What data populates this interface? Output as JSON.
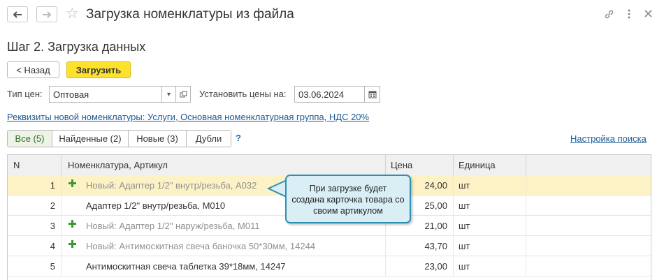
{
  "window": {
    "title": "Загрузка номенклатуры из файла"
  },
  "step_title": "Шаг 2. Загрузка данных",
  "buttons": {
    "back": "< Назад",
    "load": "Загрузить"
  },
  "form": {
    "price_type_label": "Тип цен:",
    "price_type_value": "Оптовая",
    "set_prices_label": "Установить цены на:",
    "date_value": "03.06.2024"
  },
  "details_link": "Реквизиты новой номенклатуры: Услуги, Основная номенклатурная группа, НДС 20%",
  "filter_tabs": [
    {
      "label": "Все (5)",
      "active": true
    },
    {
      "label": "Найденные (2)",
      "active": false
    },
    {
      "label": "Новые (3)",
      "active": false
    },
    {
      "label": "Дубли",
      "active": false
    }
  ],
  "help_mark": "?",
  "search_settings_link": "Настройка поиска",
  "table": {
    "columns": [
      "N",
      "Номенклатура, Артикул",
      "Цена",
      "Единица"
    ],
    "rows": [
      {
        "n": "1",
        "name": "Новый: Адаптер 1/2\" внутр/резьба, А032",
        "price": "24,00",
        "unit": "шт",
        "is_new": true,
        "selected": true
      },
      {
        "n": "2",
        "name": "Адаптер 1/2\" внутр/резьба, М010",
        "price": "25,00",
        "unit": "шт",
        "is_new": false,
        "selected": false
      },
      {
        "n": "3",
        "name": "Новый: Адаптер 1/2\" наруж/резьба, М011",
        "price": "21,00",
        "unit": "шт",
        "is_new": true,
        "selected": false
      },
      {
        "n": "4",
        "name": "Новый: Антимоскитная свеча баночка 50*30мм, 14244",
        "price": "43,70",
        "unit": "шт",
        "is_new": true,
        "selected": false
      },
      {
        "n": "5",
        "name": "Антимоскитная свеча таблетка 39*18мм, 14247",
        "price": "23,00",
        "unit": "шт",
        "is_new": false,
        "selected": false
      }
    ]
  },
  "tooltip": {
    "lines": [
      "При загрузке будет",
      "создана карточка товара со",
      "своим артикулом"
    ]
  },
  "colors": {
    "accent_yellow": "#fde22d",
    "link_blue": "#1f5a94",
    "new_plus_green": "#3a9a2f",
    "selected_row": "#fdf2c5",
    "tooltip_bg": "#d9eef5",
    "tooltip_border": "#2e8fb4"
  },
  "icons": [
    "back-arrow-icon",
    "forward-arrow-icon",
    "star-icon",
    "link-icon",
    "more-icon",
    "close-icon",
    "dropdown-icon",
    "open-icon",
    "calendar-icon",
    "plus-icon"
  ]
}
